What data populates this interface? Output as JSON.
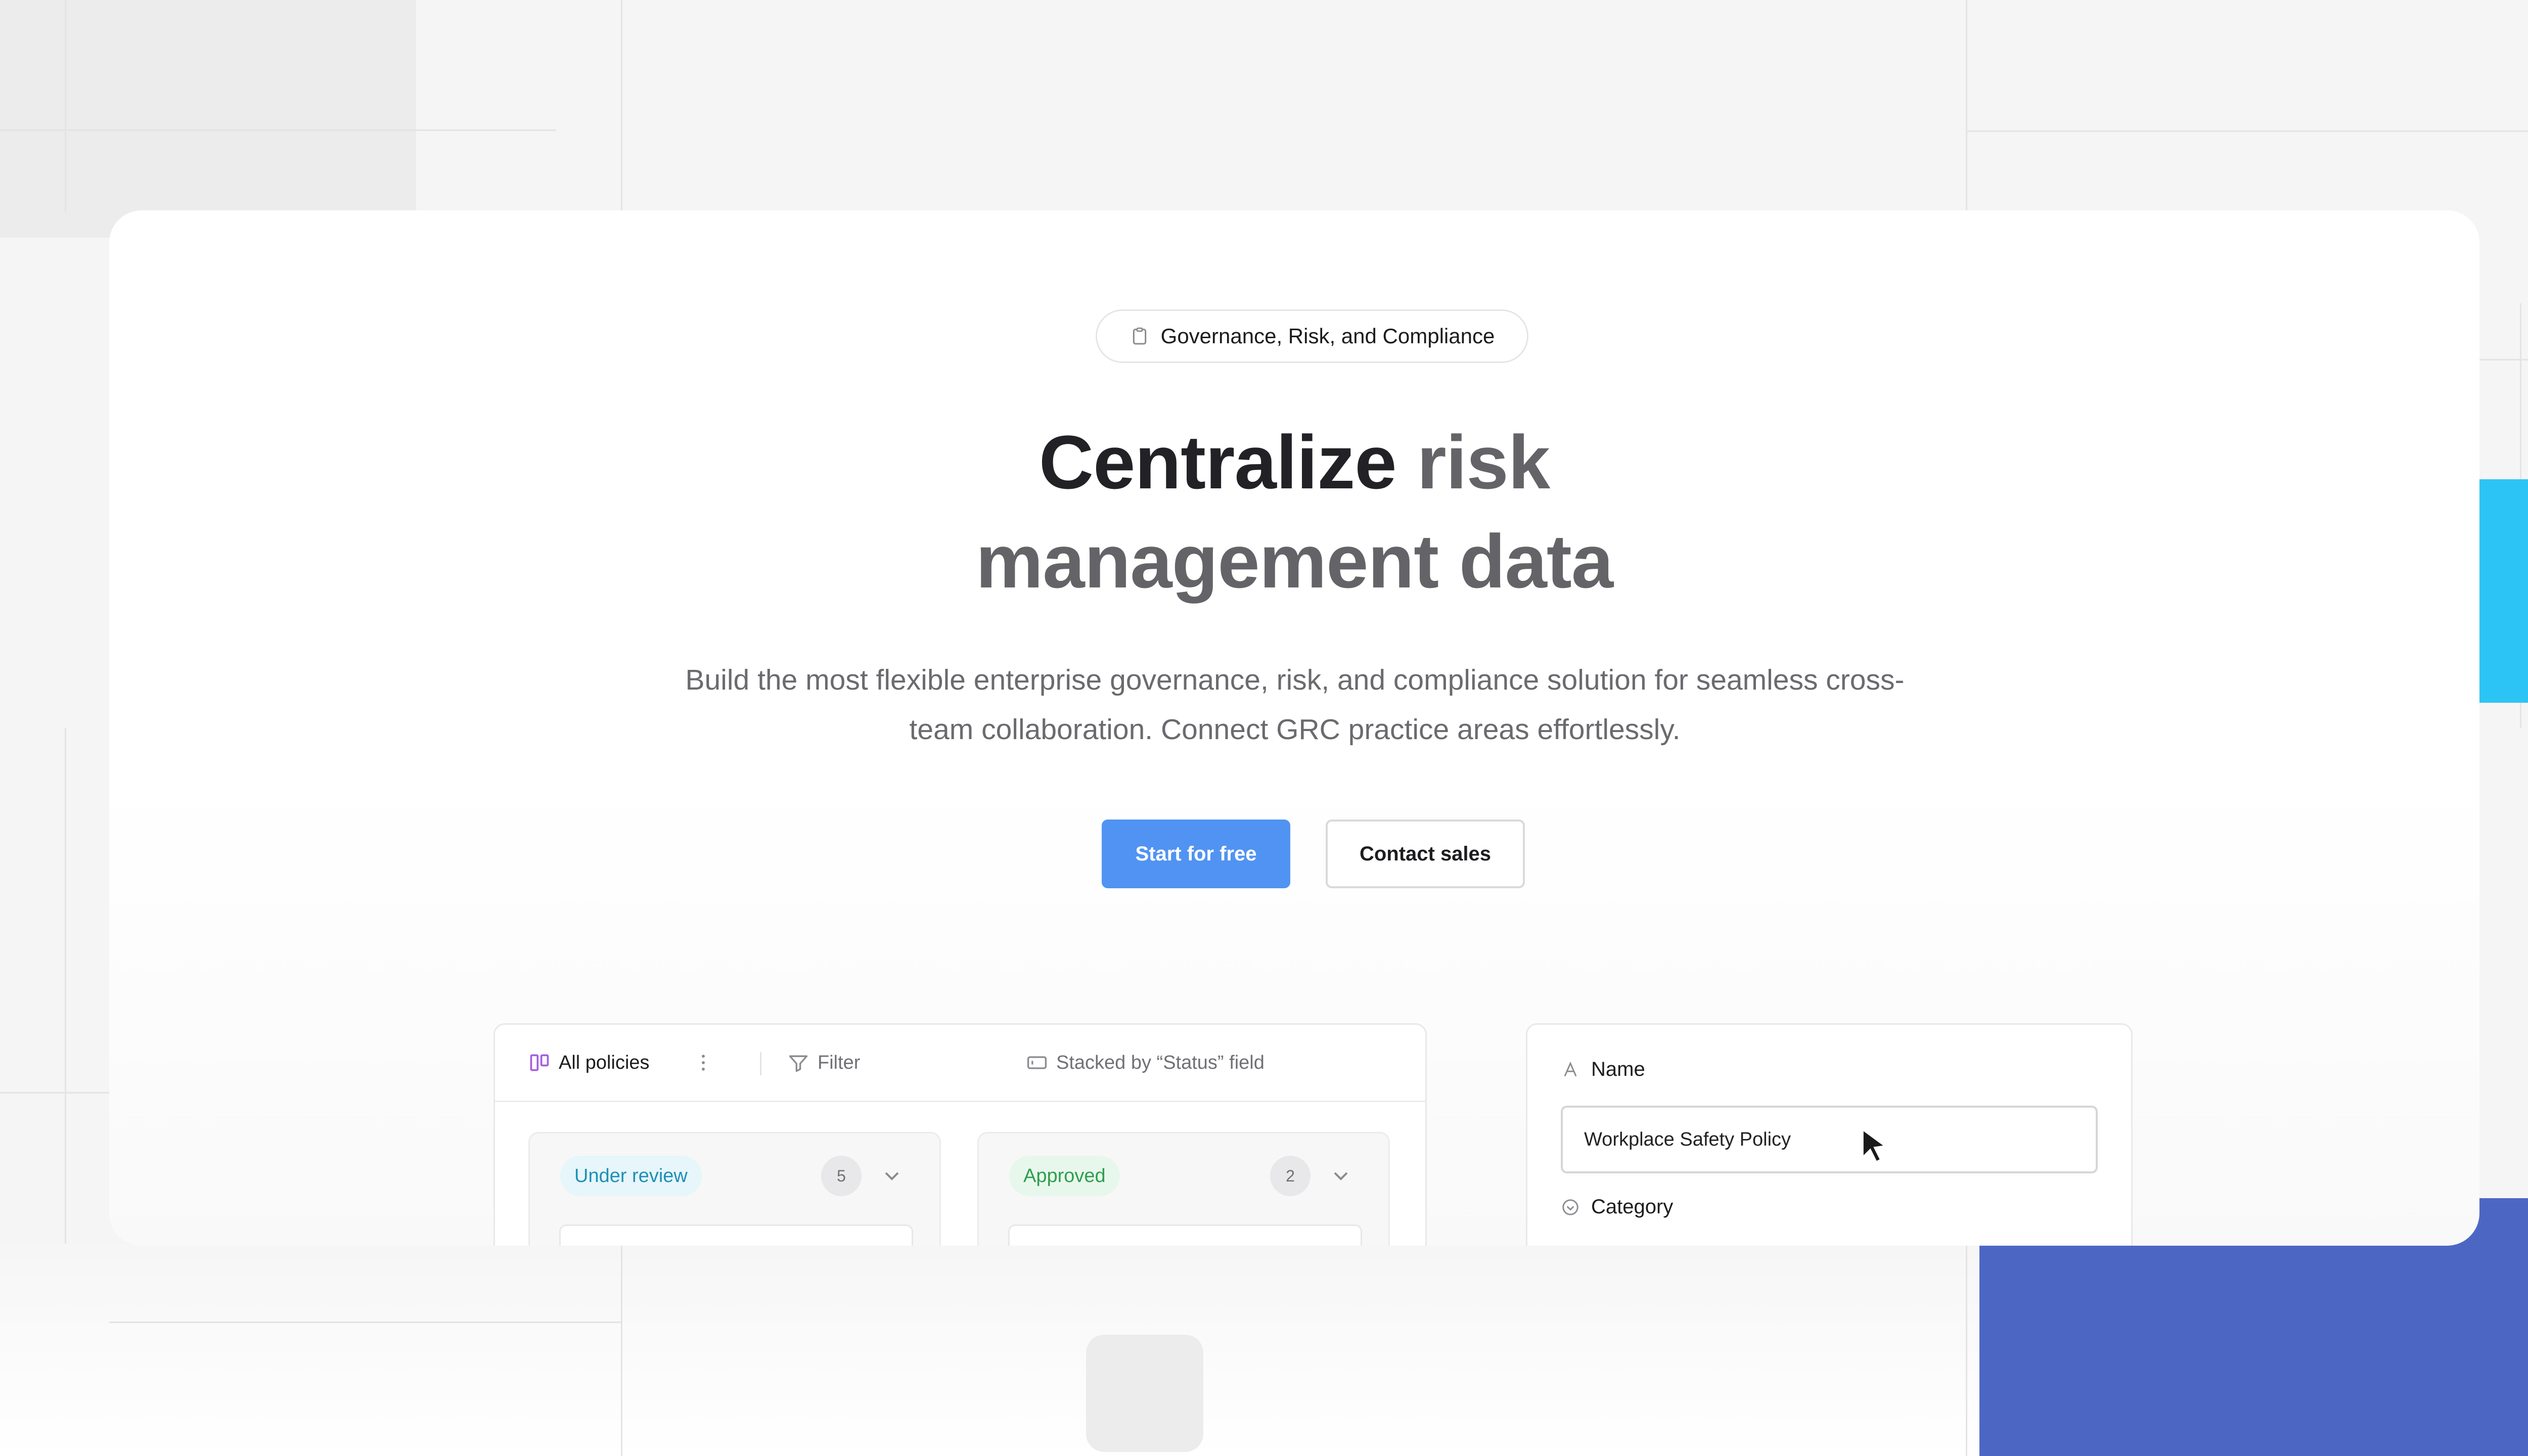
{
  "badge": {
    "icon": "clipboard-icon",
    "label": "Governance, Risk, and Compliance"
  },
  "hero": {
    "title_dark": "Centralize",
    "title_muted_1": "risk",
    "title_muted_2": "management data",
    "subtitle_line1": "Build the most flexible enterprise governance, risk, and compliance solution for seamless cross-",
    "subtitle_line2": "team collaboration. Connect GRC practice areas effortlessly."
  },
  "cta": {
    "primary": "Start for free",
    "secondary": "Contact sales"
  },
  "board": {
    "view_label": "All policies",
    "filter_label": "Filter",
    "stack_label": "Stacked by “Status” field",
    "columns": [
      {
        "label": "Under review",
        "count": "5",
        "color": "#1f8fb5",
        "bg": "#e6f6fb"
      },
      {
        "label": "Approved",
        "count": "2",
        "color": "#2e9e4e",
        "bg": "#e8f7ec"
      }
    ]
  },
  "form": {
    "name_label": "Name",
    "name_value": "Workplace Safety Policy",
    "category_label": "Category"
  },
  "colors": {
    "accent": "#5193f2",
    "cyan": "#2cc4f4",
    "indigo": "#4c67c3",
    "view_icon": "#a65ee0"
  }
}
